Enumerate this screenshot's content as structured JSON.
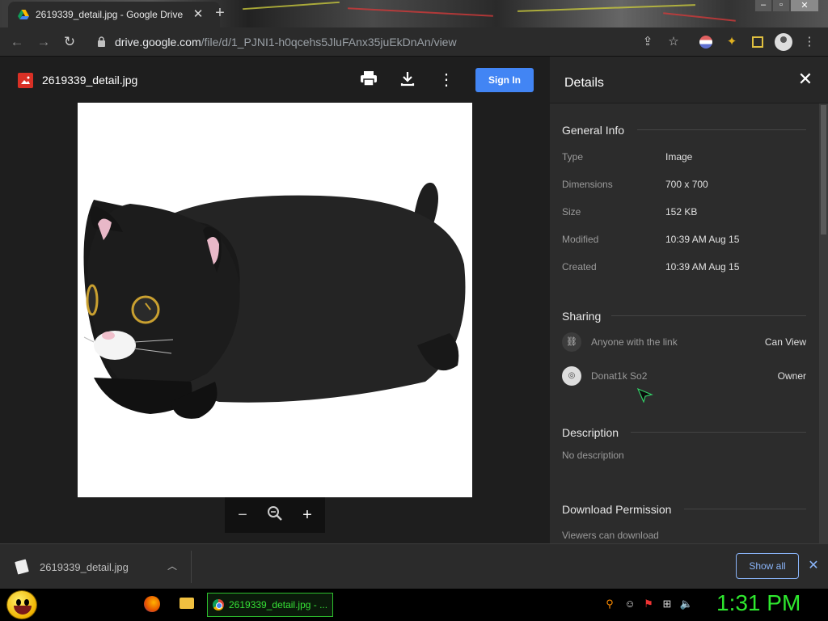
{
  "browser": {
    "tab": {
      "title": "2619339_detail.jpg - Google Drive",
      "close_label": "✕"
    },
    "new_tab_label": "+",
    "url_domain": "drive.google.com",
    "url_path": "/file/d/1_PJNI1-h0qcehs5JluFAnx35juEkDnAn/view"
  },
  "viewer": {
    "file_name": "2619339_detail.jpg",
    "sign_in_label": "Sign In",
    "zoom_out_label": "−",
    "zoom_in_label": "+"
  },
  "details": {
    "title": "Details",
    "general_info": {
      "heading": "General Info",
      "rows": [
        {
          "label": "Type",
          "value": "Image"
        },
        {
          "label": "Dimensions",
          "value": "700 x 700"
        },
        {
          "label": "Size",
          "value": "152 KB"
        },
        {
          "label": "Modified",
          "value": "10:39 AM Aug 15"
        },
        {
          "label": "Created",
          "value": "10:39 AM Aug 15"
        }
      ]
    },
    "sharing": {
      "heading": "Sharing",
      "entries": [
        {
          "name": "Anyone with the link",
          "role": "Can View"
        },
        {
          "name": "Donat1k So2",
          "role": "Owner"
        }
      ]
    },
    "description": {
      "heading": "Description",
      "text": "No description"
    },
    "download_permission": {
      "heading": "Download Permission",
      "text": "Viewers can download"
    }
  },
  "download_bar": {
    "file_name": "2619339_detail.jpg",
    "show_all_label": "Show all",
    "close_label": "✕"
  },
  "taskbar": {
    "task_label": "2619339_detail.jpg - ...",
    "clock": "1:31 PM"
  },
  "colors": {
    "accent_blue": "#4285f4",
    "link_blue": "#8ab4f8",
    "taskbar_green": "#2ee82e",
    "panel_bg": "#2c2c2c"
  }
}
